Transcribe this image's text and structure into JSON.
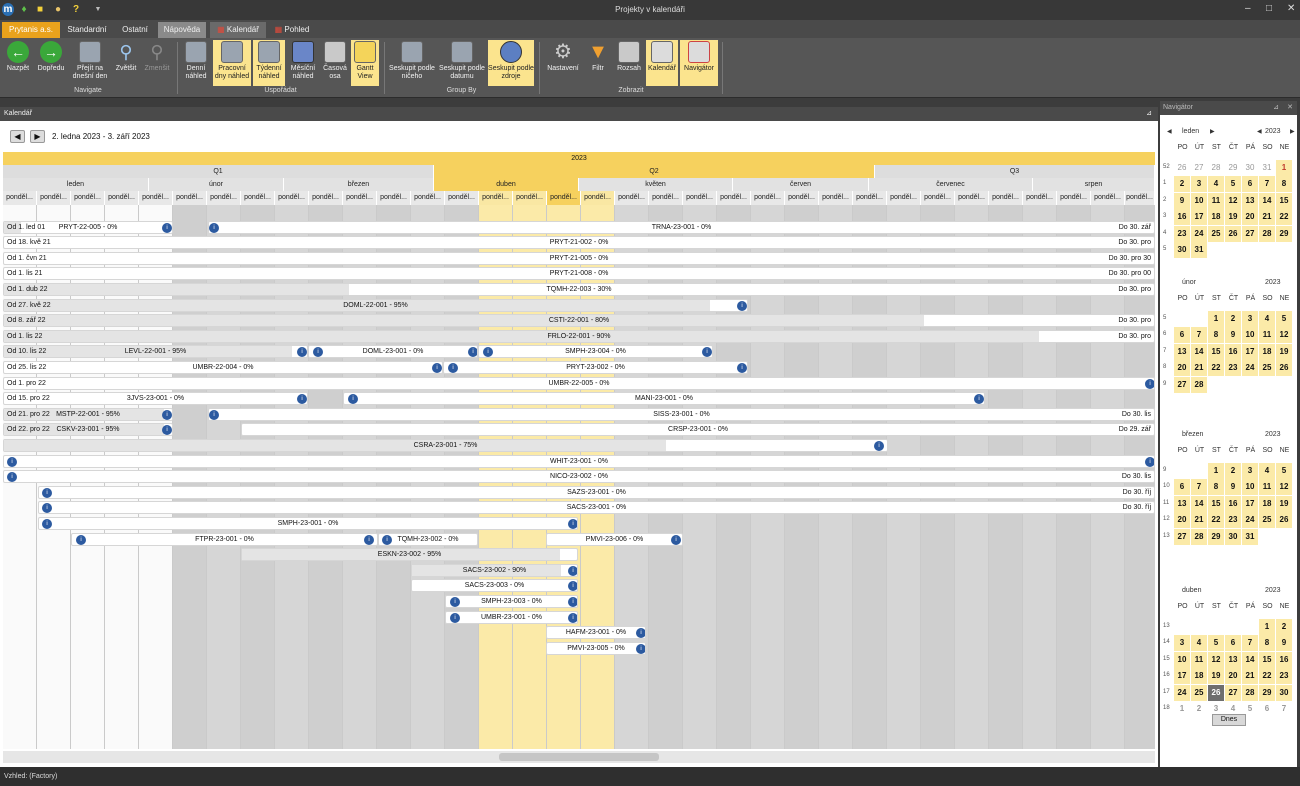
{
  "window": {
    "title": "Projekty v kalendáři"
  },
  "tabs": [
    "Prytanis a.s.",
    "Standardní",
    "Ostatní",
    "Nápověda",
    "Kalendář",
    "Pohled"
  ],
  "ribbon": {
    "buttons": [
      "Nazpět",
      "Dopředu",
      "Přejít na dnešní den",
      "Zvětšit",
      "Zmenšit",
      "Denní náhled",
      "Pracovní dny náhled",
      "Týdenní náhled",
      "Měsíční náhled",
      "Časová osa",
      "Gantt View",
      "Seskupit podle ničeho",
      "Seskupit podle datumu",
      "Seskupit podle zdroje",
      "Nastavení",
      "Filtr",
      "Rozsah",
      "Kalendář",
      "Navigátor"
    ],
    "groups": [
      "Navigate",
      "Uspořádat",
      "Group By",
      "Zobrazit"
    ]
  },
  "calendar": {
    "panel_title": "Kalendář",
    "range": "2. ledna 2023 - 3. září 2023",
    "year": "2023",
    "quarters": [
      "Q1",
      "Q2",
      "Q3"
    ],
    "months": [
      "leden",
      "únor",
      "březen",
      "duben",
      "květen",
      "červen",
      "červenec",
      "srpen"
    ],
    "week_label": "ponděl..."
  },
  "tasks": [
    {
      "from": "Od 1. led 01",
      "label": "PRYT-22-005 - 0%"
    },
    {
      "label": "TRNA-23-001 - 0%",
      "to": "Do 30. zář"
    },
    {
      "from": "Od 18. kvě 21",
      "label": "PRYT-21-002 - 0%",
      "to": "Do 30. pro"
    },
    {
      "from": "Od 1. čvn 21",
      "label": "PRYT-21-005 - 0%",
      "to": "Do 30. pro 30"
    },
    {
      "from": "Od 1. lis 21",
      "label": "PRYT-21-008 - 0%",
      "to": "Do 30. pro 00"
    },
    {
      "from": "Od 1. dub 22",
      "label": "TQMH-22-003 - 30%",
      "to": "Do 30. pro"
    },
    {
      "from": "Od 27. kvě 22",
      "label": "DOML-22-001 - 95%"
    },
    {
      "from": "Od 8. zář 22",
      "label": "CSTI-22-001 - 80%",
      "to": "Do 30. pro"
    },
    {
      "from": "Od 1. lis 22",
      "label": "FRLO-22-001 - 90%",
      "to": "Do 30. pro"
    },
    {
      "from": "Od 10. lis 22",
      "label": "LEVL-22-001 - 95%"
    },
    {
      "label": "DOML-23-001 - 0%"
    },
    {
      "label": "SMPH-23-004 - 0%"
    },
    {
      "from": "Od 25. lis 22",
      "label": "UMBR-22-004 - 0%"
    },
    {
      "label": "PRYT-23-002 - 0%"
    },
    {
      "from": "Od 1. pro 22",
      "label": "UMBR-22-005 - 0%"
    },
    {
      "from": "Od 15. pro 22",
      "label": "3JVS-23-001 - 0%"
    },
    {
      "label": "MANI-23-001 - 0%"
    },
    {
      "from": "Od 21. pro 22",
      "label": "MSTP-22-001 - 95%"
    },
    {
      "label": "SISS-23-001 - 0%",
      "to": "Do 30. lis"
    },
    {
      "from": "Od 22. pro 22",
      "label": "CSKV-23-001 - 95%"
    },
    {
      "label": "CRSP-23-001 - 0%",
      "to": "Do 29. zář"
    },
    {
      "label": "CSRA-23-001 - 75%"
    },
    {
      "label": "WHIT-23-001 - 0%"
    },
    {
      "label": "NICO-23-002 - 0%",
      "to": "Do 30. lis"
    },
    {
      "label": "SAZS-23-001 - 0%",
      "to": "Do 30. říj"
    },
    {
      "label": "SACS-23-001 - 0%",
      "to": "Do 30. říj"
    },
    {
      "label": "SMPH-23-001 - 0%"
    },
    {
      "label": "FTPR-23-001 - 0%"
    },
    {
      "label": "TQMH-23-002 - 0%"
    },
    {
      "label": "PMVI-23-006 - 0%"
    },
    {
      "label": "ESKN-23-002 - 95%"
    },
    {
      "label": "SACS-23-002 - 90%"
    },
    {
      "label": "SACS-23-003 - 0%"
    },
    {
      "label": "SMPH-23-003 - 0%"
    },
    {
      "label": "UMBR-23-001 - 0%"
    },
    {
      "label": "HAFM-23-001 - 0%"
    },
    {
      "label": "PMVI-23-005 - 0%"
    }
  ],
  "navigator": {
    "title": "Navigátor",
    "year": "2023",
    "weekdays": [
      "PO",
      "ÚT",
      "ST",
      "ČT",
      "PÁ",
      "SO",
      "NE"
    ],
    "today_button": "Dnes",
    "months": [
      {
        "name": "leden",
        "weeks": [
          {
            "n": "52",
            "days": [
              "26",
              "27",
              "28",
              "29",
              "30",
              "31",
              "1"
            ]
          },
          {
            "n": "1",
            "days": [
              "2",
              "3",
              "4",
              "5",
              "6",
              "7",
              "8"
            ]
          },
          {
            "n": "2",
            "days": [
              "9",
              "10",
              "11",
              "12",
              "13",
              "14",
              "15"
            ]
          },
          {
            "n": "3",
            "days": [
              "16",
              "17",
              "18",
              "19",
              "20",
              "21",
              "22"
            ]
          },
          {
            "n": "4",
            "days": [
              "23",
              "24",
              "25",
              "26",
              "27",
              "28",
              "29"
            ]
          },
          {
            "n": "5",
            "days": [
              "30",
              "31",
              "",
              "",
              "",
              "",
              ""
            ]
          }
        ]
      },
      {
        "name": "únor",
        "weeks": [
          {
            "n": "5",
            "days": [
              "",
              "",
              "1",
              "2",
              "3",
              "4",
              "5"
            ]
          },
          {
            "n": "6",
            "days": [
              "6",
              "7",
              "8",
              "9",
              "10",
              "11",
              "12"
            ]
          },
          {
            "n": "7",
            "days": [
              "13",
              "14",
              "15",
              "16",
              "17",
              "18",
              "19"
            ]
          },
          {
            "n": "8",
            "days": [
              "20",
              "21",
              "22",
              "23",
              "24",
              "25",
              "26"
            ]
          },
          {
            "n": "9",
            "days": [
              "27",
              "28",
              "",
              "",
              "",
              "",
              ""
            ]
          }
        ]
      },
      {
        "name": "březen",
        "weeks": [
          {
            "n": "9",
            "days": [
              "",
              "",
              "1",
              "2",
              "3",
              "4",
              "5"
            ]
          },
          {
            "n": "10",
            "days": [
              "6",
              "7",
              "8",
              "9",
              "10",
              "11",
              "12"
            ]
          },
          {
            "n": "11",
            "days": [
              "13",
              "14",
              "15",
              "16",
              "17",
              "18",
              "19"
            ]
          },
          {
            "n": "12",
            "days": [
              "20",
              "21",
              "22",
              "23",
              "24",
              "25",
              "26"
            ]
          },
          {
            "n": "13",
            "days": [
              "27",
              "28",
              "29",
              "30",
              "31",
              "",
              ""
            ]
          }
        ]
      },
      {
        "name": "duben",
        "weeks": [
          {
            "n": "13",
            "days": [
              "",
              "",
              "",
              "",
              "",
              "1",
              "2"
            ]
          },
          {
            "n": "14",
            "days": [
              "3",
              "4",
              "5",
              "6",
              "7",
              "8",
              "9"
            ]
          },
          {
            "n": "15",
            "days": [
              "10",
              "11",
              "12",
              "13",
              "14",
              "15",
              "16"
            ]
          },
          {
            "n": "16",
            "days": [
              "17",
              "18",
              "19",
              "20",
              "21",
              "22",
              "23"
            ]
          },
          {
            "n": "17",
            "days": [
              "24",
              "25",
              "26",
              "27",
              "28",
              "29",
              "30"
            ]
          },
          {
            "n": "18",
            "days": [
              "1",
              "2",
              "3",
              "4",
              "5",
              "6",
              "7"
            ]
          }
        ]
      }
    ]
  },
  "status": "Vzhled: (Factory)"
}
